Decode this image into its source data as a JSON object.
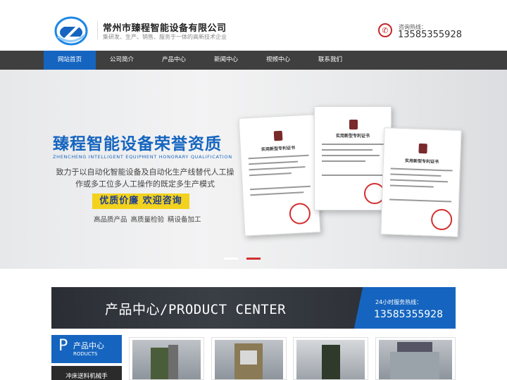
{
  "header": {
    "company_name": "常州市臻程智能设备有限公司",
    "slogan": "集研发、生产、销售、服务于一体的高新技术企业",
    "hotline_label": "咨询热线：",
    "hotline_number": "13585355928"
  },
  "nav": {
    "items": [
      {
        "label": "网站首页",
        "active": true
      },
      {
        "label": "公司简介",
        "active": false
      },
      {
        "label": "产品中心",
        "active": false
      },
      {
        "label": "新闻中心",
        "active": false
      },
      {
        "label": "视频中心",
        "active": false
      },
      {
        "label": "联系我们",
        "active": false
      }
    ]
  },
  "banner": {
    "title": "臻程智能设备荣誉资质",
    "subtitle": "ZHENCHENG INTELLIGENT EQUIPMENT HONORARY QUALIFICATION",
    "description": "致力于以自动化智能设备及自动化生产线替代人工操作或多工位多人工操作的既定多生产模式",
    "button_label": "优质价廉 欢迎咨询",
    "tags": "高品质产品  高质量检验  精设备加工",
    "certificates": [
      {
        "heading": "实用新型专利证书"
      },
      {
        "heading": "实用新型专利证书"
      },
      {
        "heading": "实用新型专利证书"
      }
    ],
    "carousel": {
      "count": 2,
      "active_index": 1
    }
  },
  "product_center": {
    "title": "产品中心/PRODUCT CENTER",
    "service_label": "24小时服务热线：",
    "service_number": "13585355928",
    "sidebar": {
      "letter": "P",
      "title": "产品中心",
      "english": "RODUCTS",
      "items": [
        "冲床送料机械手"
      ]
    }
  },
  "colors": {
    "brand_blue": "#1565c0",
    "nav_bg": "#3f3f3f",
    "accent_yellow": "#f2d21e",
    "accent_red": "#d32f2f"
  }
}
